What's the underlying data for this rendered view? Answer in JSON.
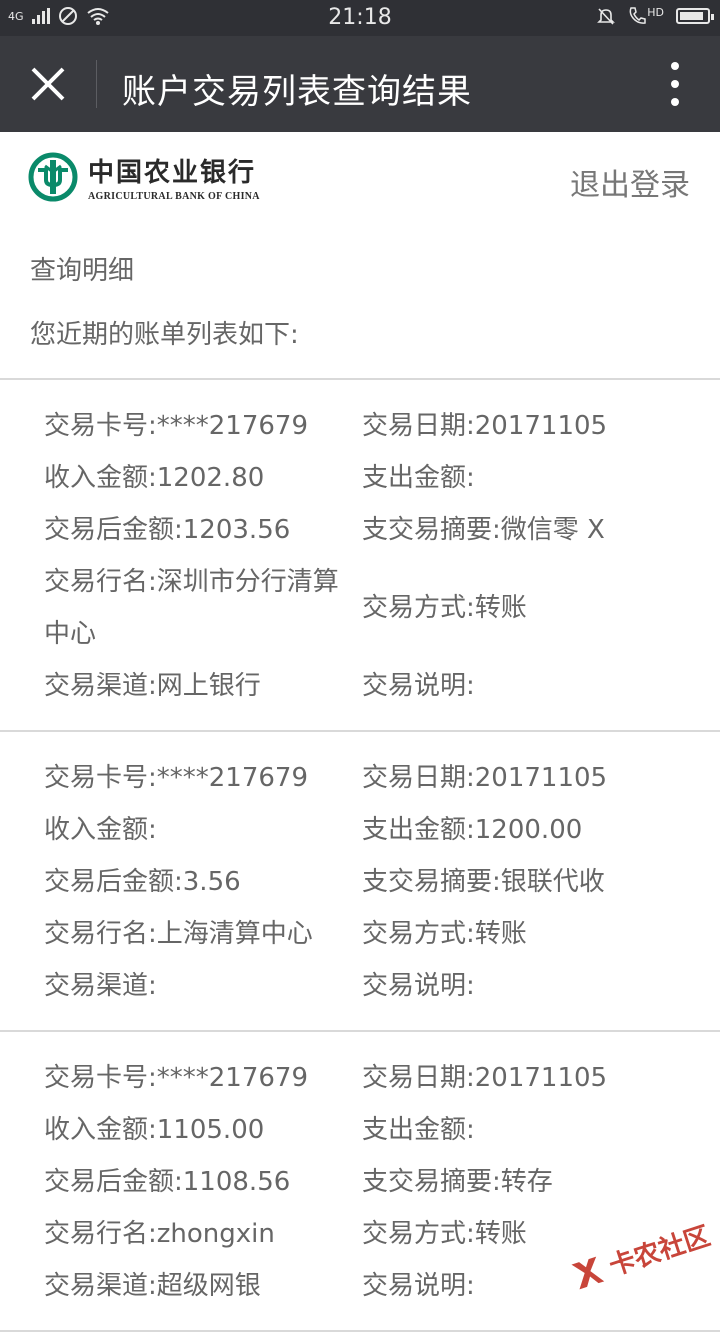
{
  "statusbar": {
    "network": "4G",
    "time": "21:18",
    "hd": "HD",
    "battery_level": 0.9
  },
  "navbar": {
    "title": "账户交易列表查询结果"
  },
  "header": {
    "bank_name_cn": "中国农业银行",
    "bank_name_en": "AGRICULTURAL BANK OF CHINA",
    "logout": "退出登录"
  },
  "section_title": "查询明细",
  "subtitle": "您近期的账单列表如下:",
  "records": [
    {
      "card_no": "交易卡号:****217679",
      "date": "交易日期:20171105",
      "income": "收入金额:1202.80",
      "expense": "支出金额:",
      "balance": "交易后金额:1203.56",
      "summary": "支交易摘要:微信零 X",
      "bank_name": "交易行名:深圳市分行清算中心",
      "method": "交易方式:转账",
      "channel": "交易渠道:网上银行",
      "note": "交易说明:"
    },
    {
      "card_no": "交易卡号:****217679",
      "date": "交易日期:20171105",
      "income": "收入金额:",
      "expense": "支出金额:1200.00",
      "balance": "交易后金额:3.56",
      "summary": "支交易摘要:银联代收",
      "bank_name": "交易行名:上海清算中心",
      "method": "交易方式:转账",
      "channel": "交易渠道:",
      "note": "交易说明:"
    },
    {
      "card_no": "交易卡号:****217679",
      "date": "交易日期:20171105",
      "income": "收入金额:1105.00",
      "expense": "支出金额:",
      "balance": "交易后金额:1108.56",
      "summary": "支交易摘要:转存",
      "bank_name": "交易行名:zhongxin",
      "method": "交易方式:转账",
      "channel": "交易渠道:超级网银",
      "note": "交易说明:"
    }
  ],
  "watermark": "卡农社区",
  "colors": {
    "statusbar_bg": "#2f3035",
    "navbar_bg": "#393a3f",
    "bank_green": "#0a8a6a",
    "text": "#666666",
    "divider": "#d9d9d9"
  }
}
